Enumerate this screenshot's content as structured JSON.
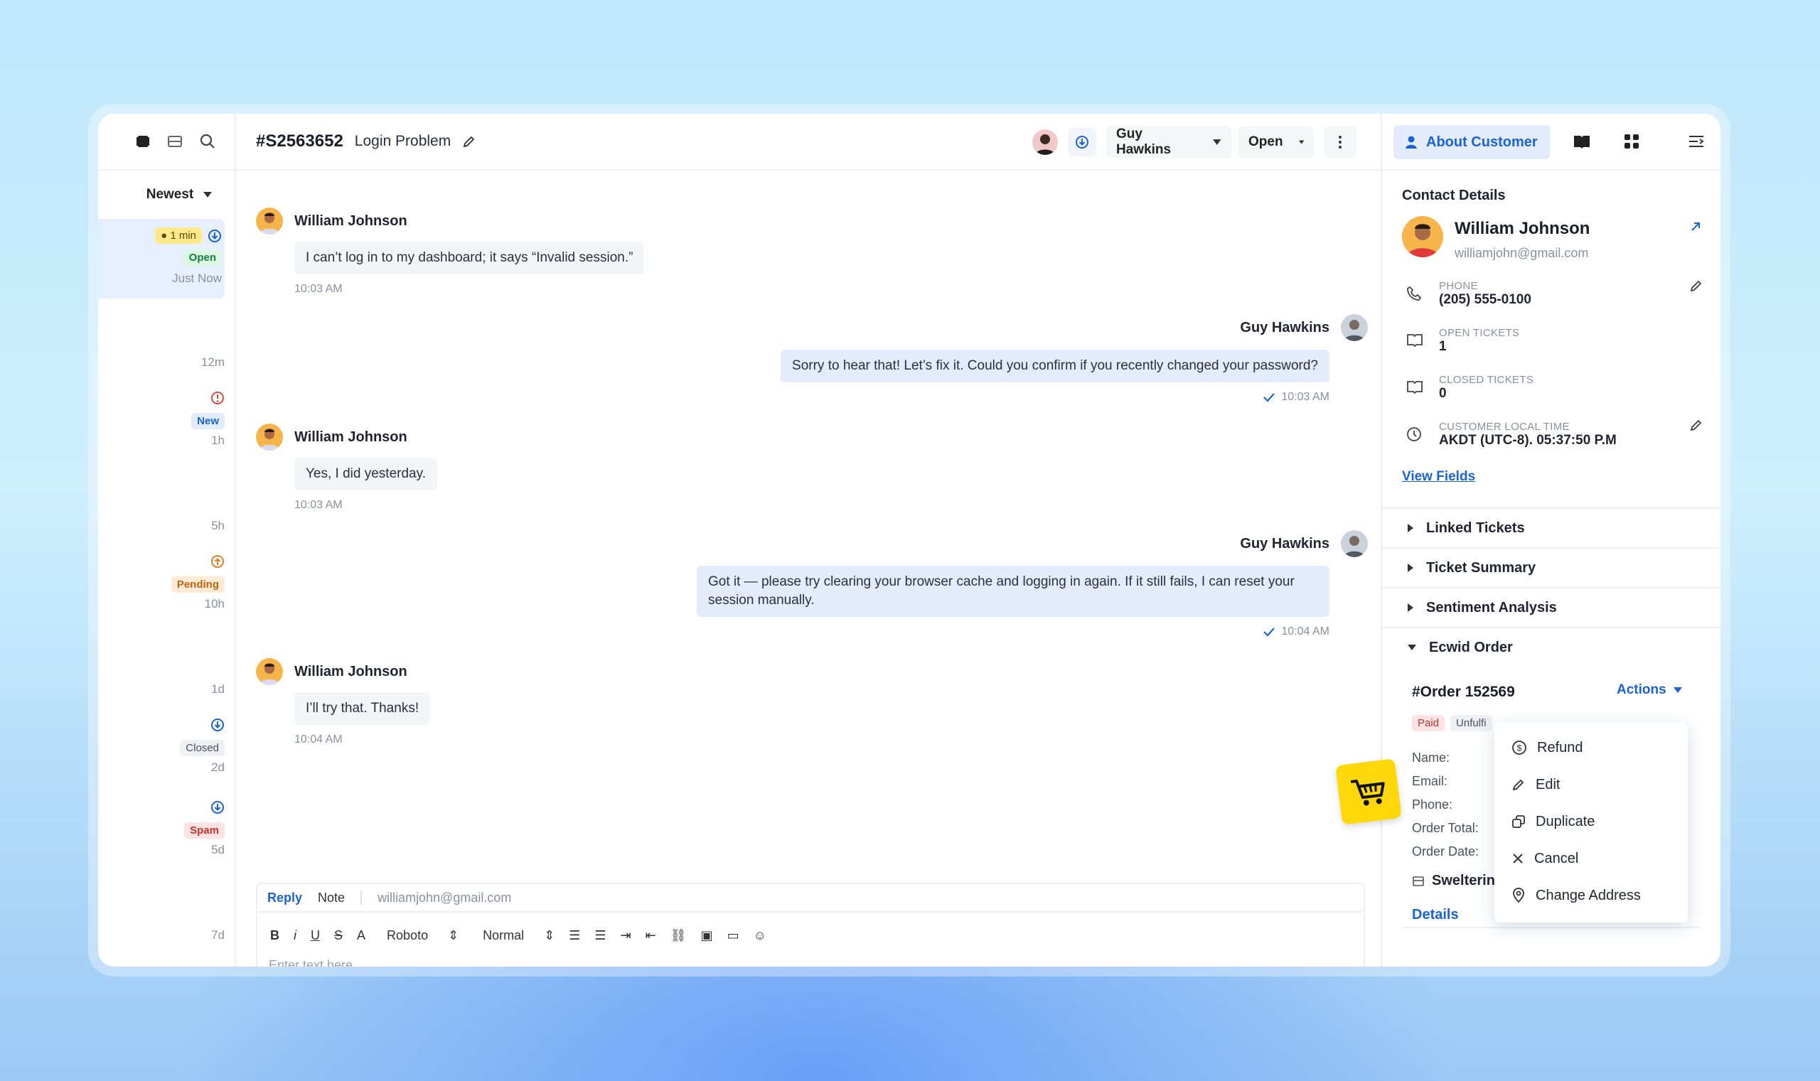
{
  "ticket": {
    "id": "#S2563652",
    "subject": "Login Problem",
    "assignee": "Guy Hawkins",
    "status": "Open"
  },
  "sort": {
    "label": "Newest"
  },
  "ticket_list": [
    {
      "timer": "1 min",
      "status": "Open",
      "time": "Just Now"
    },
    {
      "time": "12m"
    },
    {
      "status": "New",
      "time": "1h"
    },
    {
      "time": "5h"
    },
    {
      "status": "Pending",
      "time": "10h"
    },
    {
      "time": "1d"
    },
    {
      "status": "Closed",
      "time": "2d"
    },
    {
      "status": "Spam",
      "time": "5d"
    },
    {
      "time": "7d"
    }
  ],
  "messages": [
    {
      "from": "William Johnson",
      "text": "I can’t log in to my dashboard; it says “Invalid session.”",
      "time": "10:03 AM"
    },
    {
      "from": "Guy Hawkins",
      "text": "Sorry to hear that! Let’s fix it. Could you confirm if you recently changed your password?",
      "time": "10:03 AM"
    },
    {
      "from": "William Johnson",
      "text": "Yes, I did yesterday.",
      "time": "10:03 AM"
    },
    {
      "from": "Guy Hawkins",
      "text": "Got it — please try clearing your browser cache and logging in again. If it still fails, I can reset your session manually.",
      "time": "10:04 AM"
    },
    {
      "from": "William Johnson",
      "text": "I’ll try that. Thanks!",
      "time": "10:04 AM"
    }
  ],
  "composer": {
    "tab_reply": "Reply",
    "tab_note": "Note",
    "to": "williamjohn@gmail.com",
    "font": "Roboto",
    "size": "Normal",
    "placeholder": "Enter text here..."
  },
  "side": {
    "tab_label": "About Customer",
    "section_title": "Contact Details",
    "customer_name": "William Johnson",
    "customer_email": "williamjohn@gmail.com",
    "phone_label": "PHONE",
    "phone": "(205) 555-0100",
    "open_label": "OPEN TICKETS",
    "open": "1",
    "closed_label": "CLOSED TICKETS",
    "closed": "0",
    "localtime_label": "CUSTOMER LOCAL TIME",
    "localtime": "AKDT (UTC-8). 05:37:50 P.M",
    "view_fields": "View Fields",
    "acc_linked": "Linked Tickets",
    "acc_summary": "Ticket Summary",
    "acc_sentiment": "Sentiment Analysis",
    "acc_ecwid": "Ecwid Order"
  },
  "order": {
    "number": "#Order 152569",
    "actions": "Actions",
    "tag_paid": "Paid",
    "tag_unfulfilled": "Unfulfi",
    "name_label": "Name:",
    "email_label": "Email:",
    "phone_label": "Phone:",
    "total_label": "Order Total:",
    "date_label": "Order Date:",
    "store": "Swelterin",
    "details": "Details"
  },
  "actions_menu": [
    "Refund",
    "Edit",
    "Duplicate",
    "Cancel",
    "Change Address"
  ],
  "colors": {
    "accent": "#1a63d6",
    "green": "#15a34a",
    "red": "#e0483e",
    "orange": "#e67e22"
  }
}
